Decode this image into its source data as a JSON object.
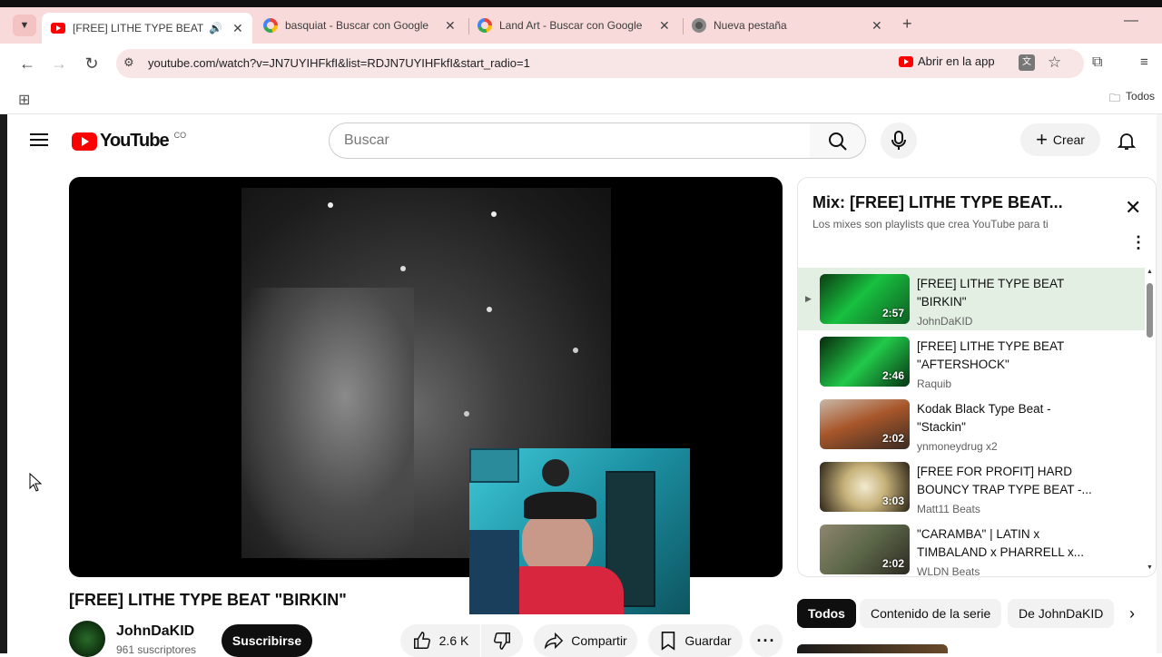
{
  "browser": {
    "tabs": [
      {
        "title": "[FREE] LITHE TYPE BEAT \"BIRKIN\"",
        "icon": "youtube-icon",
        "active": true
      },
      {
        "title": "basquiat - Buscar con Google",
        "icon": "google-icon"
      },
      {
        "title": "Land Art - Buscar con Google",
        "icon": "google-icon"
      },
      {
        "title": "Nueva pestaña",
        "icon": "chrome-icon"
      }
    ],
    "url": "youtube.com/watch?v=JN7UYIHFkfI&list=RDJN7UYIHFkfI&start_radio=1",
    "open_in_app": "Abrir en la app",
    "bookmarks_all": "Todos"
  },
  "youtube": {
    "logo": "YouTube",
    "country": "CO",
    "search_placeholder": "Buscar",
    "create_label": "Crear",
    "video_title": "[FREE] LITHE TYPE BEAT \"BIRKIN\"",
    "channel": {
      "name": "JohnDaKID",
      "subscribers": "961 suscriptores"
    },
    "subscribe_label": "Suscribirse",
    "likes": "2.6 K",
    "share_label": "Compartir",
    "save_label": "Guardar"
  },
  "playlist": {
    "title": "Mix: [FREE] LITHE TYPE BEAT...",
    "subtitle": "Los mixes son playlists que crea YouTube para ti",
    "items": [
      {
        "title": "[FREE] LITHE TYPE BEAT \"BIRKIN\"",
        "channel": "JohnDaKID",
        "duration": "2:57",
        "active": true
      },
      {
        "title": "[FREE] LITHE TYPE BEAT \"AFTERSHOCK\"",
        "channel": "Raquib",
        "duration": "2:46"
      },
      {
        "title": "Kodak Black Type Beat - \"Stackin\"",
        "channel": "ynmoneydrug x2",
        "duration": "2:02"
      },
      {
        "title": "[FREE FOR PROFIT] HARD BOUNCY TRAP TYPE BEAT -...",
        "channel": "Matt11 Beats",
        "duration": "3:03"
      },
      {
        "title": "\"CARAMBA\" | LATIN x TIMBALAND x PHARRELL x...",
        "channel": "WLDN Beats",
        "duration": "2:02"
      }
    ]
  },
  "chips": [
    "Todos",
    "Contenido de la serie",
    "De JohnDaKID"
  ],
  "colors": {
    "youtube_red": "#ff0000",
    "tabstrip": "#f9dada",
    "active_item": "#e4efe4"
  }
}
